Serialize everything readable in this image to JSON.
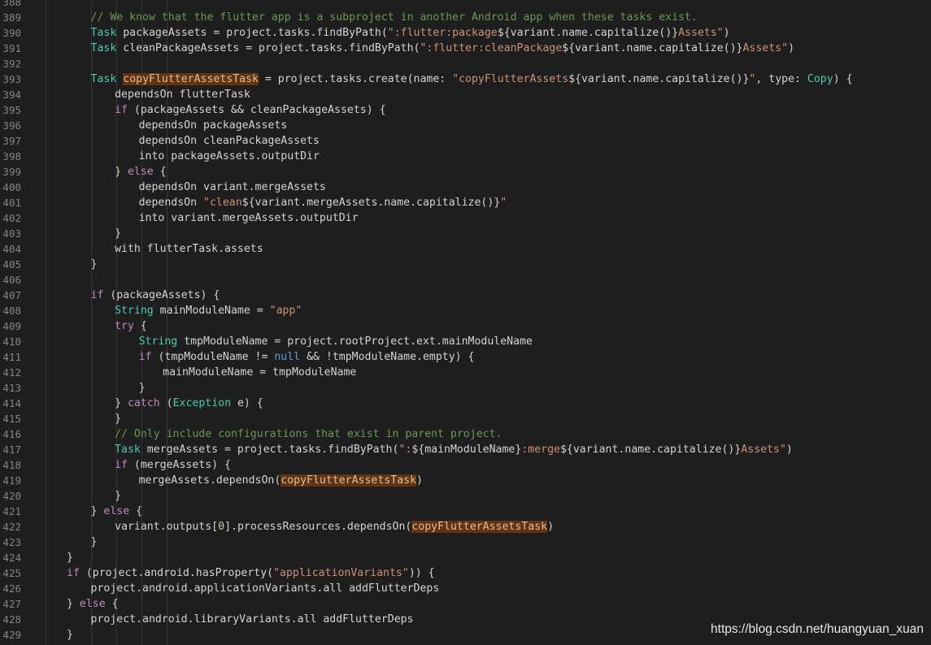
{
  "editor": {
    "colors": {
      "background": "#1e1e1e",
      "line_number": "#858585",
      "plain": "#d4d4d4",
      "keyword": "#c586c0",
      "keyword_blue": "#569cd6",
      "type": "#4ec9b0",
      "string": "#ce9178",
      "comment": "#6a9955",
      "number": "#b5cea8",
      "highlight_bg": "#613214"
    },
    "lines": [
      {
        "n": "388",
        "indent": 0,
        "tokens": []
      },
      {
        "n": "389",
        "indent": 16,
        "tokens": [
          [
            "comment",
            "// We know that the flutter app is a subproject in another Android app when these tasks exist."
          ]
        ]
      },
      {
        "n": "390",
        "indent": 16,
        "tokens": [
          [
            "type",
            "Task"
          ],
          [
            "plain",
            " packageAssets = project.tasks.findByPath("
          ],
          [
            "string",
            "\":flutter:package"
          ],
          [
            "interp",
            "${"
          ],
          [
            "plain",
            "variant.name.capitalize()"
          ],
          [
            "interp",
            "}"
          ],
          [
            "string",
            "Assets\""
          ],
          [
            "plain",
            ")"
          ]
        ]
      },
      {
        "n": "391",
        "indent": 16,
        "tokens": [
          [
            "type",
            "Task"
          ],
          [
            "plain",
            " cleanPackageAssets = project.tasks.findByPath("
          ],
          [
            "string",
            "\":flutter:cleanPackage"
          ],
          [
            "interp",
            "${"
          ],
          [
            "plain",
            "variant.name.capitalize()"
          ],
          [
            "interp",
            "}"
          ],
          [
            "string",
            "Assets\""
          ],
          [
            "plain",
            ")"
          ]
        ]
      },
      {
        "n": "392",
        "indent": 0,
        "tokens": []
      },
      {
        "n": "393",
        "indent": 16,
        "tokens": [
          [
            "type",
            "Task"
          ],
          [
            "plain",
            " "
          ],
          [
            "hl",
            "copyFlutterAssetsTask"
          ],
          [
            "plain",
            " = project.tasks.create(name: "
          ],
          [
            "string",
            "\"copyFlutterAssets"
          ],
          [
            "interp",
            "${"
          ],
          [
            "plain",
            "variant.name.capitalize()"
          ],
          [
            "interp",
            "}"
          ],
          [
            "string",
            "\""
          ],
          [
            "plain",
            ", type: "
          ],
          [
            "type",
            "Copy"
          ],
          [
            "plain",
            ") {"
          ]
        ]
      },
      {
        "n": "394",
        "indent": 20,
        "tokens": [
          [
            "plain",
            "dependsOn flutterTask"
          ]
        ]
      },
      {
        "n": "395",
        "indent": 20,
        "tokens": [
          [
            "kw",
            "if"
          ],
          [
            "plain",
            " (packageAssets && cleanPackageAssets) {"
          ]
        ]
      },
      {
        "n": "396",
        "indent": 24,
        "tokens": [
          [
            "plain",
            "dependsOn packageAssets"
          ]
        ]
      },
      {
        "n": "397",
        "indent": 24,
        "tokens": [
          [
            "plain",
            "dependsOn cleanPackageAssets"
          ]
        ]
      },
      {
        "n": "398",
        "indent": 24,
        "tokens": [
          [
            "plain",
            "into packageAssets.outputDir"
          ]
        ]
      },
      {
        "n": "399",
        "indent": 20,
        "tokens": [
          [
            "plain",
            "} "
          ],
          [
            "kw",
            "else"
          ],
          [
            "plain",
            " {"
          ]
        ]
      },
      {
        "n": "400",
        "indent": 24,
        "tokens": [
          [
            "plain",
            "dependsOn variant.mergeAssets"
          ]
        ]
      },
      {
        "n": "401",
        "indent": 24,
        "tokens": [
          [
            "plain",
            "dependsOn "
          ],
          [
            "string",
            "\"clean"
          ],
          [
            "interp",
            "${"
          ],
          [
            "plain",
            "variant.mergeAssets.name.capitalize()"
          ],
          [
            "interp",
            "}"
          ],
          [
            "string",
            "\""
          ]
        ]
      },
      {
        "n": "402",
        "indent": 24,
        "tokens": [
          [
            "plain",
            "into variant.mergeAssets.outputDir"
          ]
        ]
      },
      {
        "n": "403",
        "indent": 20,
        "tokens": [
          [
            "plain",
            "}"
          ]
        ]
      },
      {
        "n": "404",
        "indent": 20,
        "tokens": [
          [
            "plain",
            "with flutterTask.assets"
          ]
        ]
      },
      {
        "n": "405",
        "indent": 16,
        "tokens": [
          [
            "plain",
            "}"
          ]
        ]
      },
      {
        "n": "406",
        "indent": 0,
        "tokens": []
      },
      {
        "n": "407",
        "indent": 16,
        "tokens": [
          [
            "kw",
            "if"
          ],
          [
            "plain",
            " (packageAssets) {"
          ]
        ]
      },
      {
        "n": "408",
        "indent": 20,
        "tokens": [
          [
            "type",
            "String"
          ],
          [
            "plain",
            " mainModuleName = "
          ],
          [
            "string",
            "\"app\""
          ]
        ]
      },
      {
        "n": "409",
        "indent": 20,
        "tokens": [
          [
            "kw",
            "try"
          ],
          [
            "plain",
            " {"
          ]
        ]
      },
      {
        "n": "410",
        "indent": 24,
        "tokens": [
          [
            "type",
            "String"
          ],
          [
            "plain",
            " tmpModuleName = project.rootProject.ext.mainModuleName"
          ]
        ]
      },
      {
        "n": "411",
        "indent": 24,
        "tokens": [
          [
            "kw",
            "if"
          ],
          [
            "plain",
            " (tmpModuleName != "
          ],
          [
            "blue",
            "null"
          ],
          [
            "plain",
            " && !tmpModuleName.empty) {"
          ]
        ]
      },
      {
        "n": "412",
        "indent": 28,
        "tokens": [
          [
            "plain",
            "mainModuleName = tmpModuleName"
          ]
        ]
      },
      {
        "n": "413",
        "indent": 24,
        "tokens": [
          [
            "plain",
            "}"
          ]
        ]
      },
      {
        "n": "414",
        "indent": 20,
        "tokens": [
          [
            "plain",
            "} "
          ],
          [
            "kw",
            "catch"
          ],
          [
            "plain",
            " ("
          ],
          [
            "type",
            "Exception"
          ],
          [
            "plain",
            " e) {"
          ]
        ]
      },
      {
        "n": "415",
        "indent": 20,
        "tokens": [
          [
            "plain",
            "}"
          ]
        ]
      },
      {
        "n": "416",
        "indent": 20,
        "tokens": [
          [
            "comment",
            "// Only include configurations that exist in parent project."
          ]
        ]
      },
      {
        "n": "417",
        "indent": 20,
        "tokens": [
          [
            "type",
            "Task"
          ],
          [
            "plain",
            " mergeAssets = project.tasks.findByPath("
          ],
          [
            "string",
            "\":"
          ],
          [
            "interp",
            "${"
          ],
          [
            "plain",
            "mainModuleName"
          ],
          [
            "interp",
            "}"
          ],
          [
            "string",
            ":merge"
          ],
          [
            "interp",
            "${"
          ],
          [
            "plain",
            "variant.name.capitalize()"
          ],
          [
            "interp",
            "}"
          ],
          [
            "string",
            "Assets\""
          ],
          [
            "plain",
            ")"
          ]
        ]
      },
      {
        "n": "418",
        "indent": 20,
        "tokens": [
          [
            "kw",
            "if"
          ],
          [
            "plain",
            " (mergeAssets) {"
          ]
        ]
      },
      {
        "n": "419",
        "indent": 24,
        "tokens": [
          [
            "plain",
            "mergeAssets.dependsOn("
          ],
          [
            "hl2",
            "copyFlutterAssetsTask"
          ],
          [
            "plain",
            ")"
          ]
        ]
      },
      {
        "n": "420",
        "indent": 20,
        "tokens": [
          [
            "plain",
            "}"
          ]
        ]
      },
      {
        "n": "421",
        "indent": 16,
        "tokens": [
          [
            "plain",
            "} "
          ],
          [
            "kw",
            "else"
          ],
          [
            "plain",
            " {"
          ]
        ]
      },
      {
        "n": "422",
        "indent": 20,
        "tokens": [
          [
            "plain",
            "variant.outputs["
          ],
          [
            "num",
            "0"
          ],
          [
            "plain",
            "].processResources.dependsOn("
          ],
          [
            "hl2",
            "copyFlutterAssetsTask"
          ],
          [
            "plain",
            ")"
          ]
        ]
      },
      {
        "n": "423",
        "indent": 16,
        "tokens": [
          [
            "plain",
            "}"
          ]
        ]
      },
      {
        "n": "424",
        "indent": 12,
        "tokens": [
          [
            "plain",
            "}"
          ]
        ]
      },
      {
        "n": "425",
        "indent": 12,
        "tokens": [
          [
            "kw",
            "if"
          ],
          [
            "plain",
            " (project.android.hasProperty("
          ],
          [
            "string",
            "\"applicationVariants\""
          ],
          [
            "plain",
            ")) {"
          ]
        ]
      },
      {
        "n": "426",
        "indent": 16,
        "tokens": [
          [
            "plain",
            "project.android.applicationVariants.all addFlutterDeps"
          ]
        ]
      },
      {
        "n": "427",
        "indent": 12,
        "tokens": [
          [
            "plain",
            "} "
          ],
          [
            "kw",
            "else"
          ],
          [
            "plain",
            " {"
          ]
        ]
      },
      {
        "n": "428",
        "indent": 16,
        "tokens": [
          [
            "plain",
            "project.android.libraryVariants.all addFlutterDeps"
          ]
        ]
      },
      {
        "n": "429",
        "indent": 12,
        "tokens": [
          [
            "plain",
            "}"
          ]
        ]
      }
    ]
  },
  "watermark": "https://blog.csdn.net/huangyuan_xuan"
}
